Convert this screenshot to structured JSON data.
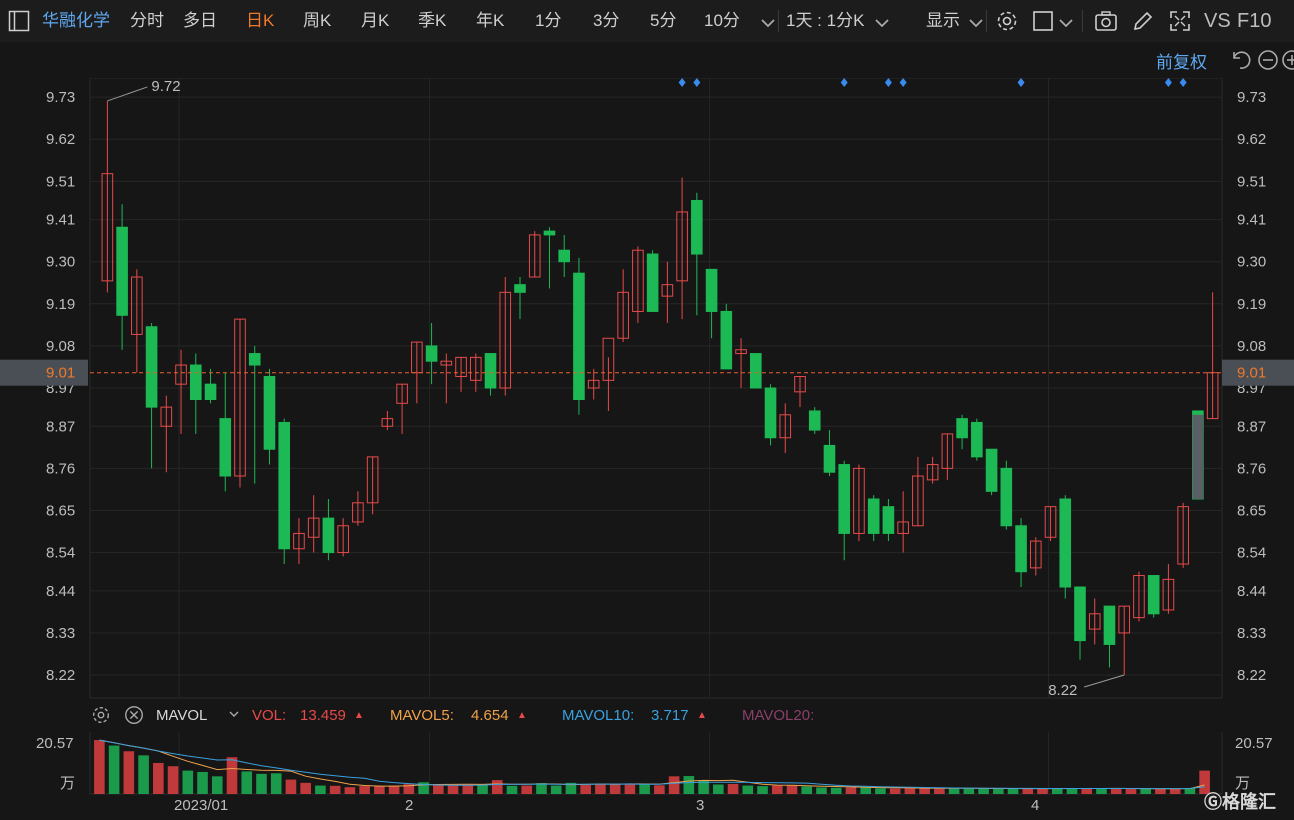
{
  "toolbar": {
    "stock_name": "华融化学",
    "periods": [
      "分时",
      "多日",
      "日K",
      "周K",
      "月K",
      "季K",
      "年K",
      "1分",
      "3分",
      "5分",
      "10分"
    ],
    "active_period": "日K",
    "combo": "1天 : 1分K",
    "display": "显示",
    "vs": "VS",
    "f10": "F10"
  },
  "fuquan": "前复权",
  "colors": {
    "up": "#e84a4a",
    "down": "#1db954",
    "ma5": "#f0a24a",
    "ma10": "#3aa0e0",
    "ma20": "#8a3f6a",
    "price_line": "#e8622a",
    "bg": "#161616",
    "grid": "#262626",
    "markers": "#3a8af0"
  },
  "price_axis": {
    "ticks": [
      "9.73",
      "9.62",
      "9.51",
      "9.41",
      "9.30",
      "9.19",
      "9.08",
      "8.97",
      "8.87",
      "8.76",
      "8.65",
      "8.54",
      "8.44",
      "8.33",
      "8.22"
    ],
    "current": "9.01",
    "high_label": "9.72",
    "low_label": "8.22"
  },
  "chart_data": {
    "type": "candlestick",
    "ylim": [
      8.16,
      9.78
    ],
    "candles": [
      {
        "o": 9.25,
        "h": 9.72,
        "l": 9.22,
        "c": 9.53
      },
      {
        "o": 9.39,
        "h": 9.45,
        "l": 9.07,
        "c": 9.16
      },
      {
        "o": 9.11,
        "h": 9.28,
        "l": 9.01,
        "c": 9.26
      },
      {
        "o": 9.13,
        "h": 9.14,
        "l": 8.76,
        "c": 8.92
      },
      {
        "o": 8.87,
        "h": 8.95,
        "l": 8.75,
        "c": 8.92
      },
      {
        "o": 8.98,
        "h": 9.07,
        "l": 8.85,
        "c": 9.03
      },
      {
        "o": 9.03,
        "h": 9.06,
        "l": 8.85,
        "c": 8.94
      },
      {
        "o": 8.98,
        "h": 9.02,
        "l": 8.93,
        "c": 8.94
      },
      {
        "o": 8.89,
        "h": 9.01,
        "l": 8.7,
        "c": 8.74
      },
      {
        "o": 8.74,
        "h": 9.15,
        "l": 8.71,
        "c": 9.15
      },
      {
        "o": 9.06,
        "h": 9.08,
        "l": 8.72,
        "c": 9.03
      },
      {
        "o": 9.0,
        "h": 9.02,
        "l": 8.77,
        "c": 8.81
      },
      {
        "o": 8.88,
        "h": 8.89,
        "l": 8.51,
        "c": 8.55
      },
      {
        "o": 8.55,
        "h": 8.63,
        "l": 8.51,
        "c": 8.59
      },
      {
        "o": 8.58,
        "h": 8.69,
        "l": 8.54,
        "c": 8.63
      },
      {
        "o": 8.63,
        "h": 8.68,
        "l": 8.52,
        "c": 8.54
      },
      {
        "o": 8.54,
        "h": 8.63,
        "l": 8.53,
        "c": 8.61
      },
      {
        "o": 8.62,
        "h": 8.7,
        "l": 8.61,
        "c": 8.67
      },
      {
        "o": 8.67,
        "h": 8.79,
        "l": 8.64,
        "c": 8.79
      },
      {
        "o": 8.87,
        "h": 8.91,
        "l": 8.86,
        "c": 8.89
      },
      {
        "o": 8.93,
        "h": 8.98,
        "l": 8.85,
        "c": 8.98
      },
      {
        "o": 9.01,
        "h": 9.09,
        "l": 8.93,
        "c": 9.09
      },
      {
        "o": 9.08,
        "h": 9.14,
        "l": 8.98,
        "c": 9.04
      },
      {
        "o": 9.03,
        "h": 9.06,
        "l": 8.93,
        "c": 9.04
      },
      {
        "o": 9.0,
        "h": 9.05,
        "l": 8.96,
        "c": 9.05
      },
      {
        "o": 8.99,
        "h": 9.06,
        "l": 8.96,
        "c": 9.05
      },
      {
        "o": 9.06,
        "h": 9.06,
        "l": 8.95,
        "c": 8.97
      },
      {
        "o": 8.97,
        "h": 9.26,
        "l": 8.95,
        "c": 9.22
      },
      {
        "o": 9.24,
        "h": 9.26,
        "l": 9.15,
        "c": 9.22
      },
      {
        "o": 9.26,
        "h": 9.38,
        "l": 9.26,
        "c": 9.37
      },
      {
        "o": 9.38,
        "h": 9.39,
        "l": 9.23,
        "c": 9.37
      },
      {
        "o": 9.33,
        "h": 9.37,
        "l": 9.26,
        "c": 9.3
      },
      {
        "o": 9.27,
        "h": 9.31,
        "l": 8.9,
        "c": 8.94
      },
      {
        "o": 8.97,
        "h": 9.02,
        "l": 8.94,
        "c": 8.99
      },
      {
        "o": 8.99,
        "h": 9.05,
        "l": 8.91,
        "c": 9.1
      },
      {
        "o": 9.1,
        "h": 9.28,
        "l": 9.09,
        "c": 9.22
      },
      {
        "o": 9.17,
        "h": 9.34,
        "l": 9.14,
        "c": 9.33
      },
      {
        "o": 9.32,
        "h": 9.33,
        "l": 9.18,
        "c": 9.17
      },
      {
        "o": 9.21,
        "h": 9.3,
        "l": 9.14,
        "c": 9.24
      },
      {
        "o": 9.25,
        "h": 9.52,
        "l": 9.15,
        "c": 9.43
      },
      {
        "o": 9.46,
        "h": 9.48,
        "l": 9.16,
        "c": 9.32
      },
      {
        "o": 9.28,
        "h": 9.28,
        "l": 9.1,
        "c": 9.17
      },
      {
        "o": 9.17,
        "h": 9.19,
        "l": 9.02,
        "c": 9.02
      },
      {
        "o": 9.06,
        "h": 9.1,
        "l": 8.97,
        "c": 9.07
      },
      {
        "o": 9.06,
        "h": 9.06,
        "l": 8.97,
        "c": 8.97
      },
      {
        "o": 8.97,
        "h": 8.98,
        "l": 8.82,
        "c": 8.84
      },
      {
        "o": 8.84,
        "h": 8.93,
        "l": 8.8,
        "c": 8.9
      },
      {
        "o": 8.96,
        "h": 9.0,
        "l": 8.92,
        "c": 9.0
      },
      {
        "o": 8.91,
        "h": 8.92,
        "l": 8.85,
        "c": 8.86
      },
      {
        "o": 8.82,
        "h": 8.86,
        "l": 8.74,
        "c": 8.75
      },
      {
        "o": 8.77,
        "h": 8.78,
        "l": 8.52,
        "c": 8.59
      },
      {
        "o": 8.59,
        "h": 8.77,
        "l": 8.57,
        "c": 8.76
      },
      {
        "o": 8.68,
        "h": 8.69,
        "l": 8.57,
        "c": 8.59
      },
      {
        "o": 8.66,
        "h": 8.68,
        "l": 8.57,
        "c": 8.59
      },
      {
        "o": 8.59,
        "h": 8.7,
        "l": 8.54,
        "c": 8.62
      },
      {
        "o": 8.61,
        "h": 8.79,
        "l": 8.61,
        "c": 8.74
      },
      {
        "o": 8.73,
        "h": 8.79,
        "l": 8.72,
        "c": 8.77
      },
      {
        "o": 8.76,
        "h": 8.85,
        "l": 8.73,
        "c": 8.85
      },
      {
        "o": 8.89,
        "h": 8.9,
        "l": 8.81,
        "c": 8.84
      },
      {
        "o": 8.88,
        "h": 8.89,
        "l": 8.78,
        "c": 8.79
      },
      {
        "o": 8.81,
        "h": 8.81,
        "l": 8.69,
        "c": 8.7
      },
      {
        "o": 8.76,
        "h": 8.78,
        "l": 8.6,
        "c": 8.61
      },
      {
        "o": 8.61,
        "h": 8.63,
        "l": 8.45,
        "c": 8.49
      },
      {
        "o": 8.5,
        "h": 8.58,
        "l": 8.48,
        "c": 8.57
      },
      {
        "o": 8.58,
        "h": 8.66,
        "l": 8.57,
        "c": 8.66
      },
      {
        "o": 8.68,
        "h": 8.69,
        "l": 8.42,
        "c": 8.45
      },
      {
        "o": 8.45,
        "h": 8.45,
        "l": 8.26,
        "c": 8.31
      },
      {
        "o": 8.34,
        "h": 8.42,
        "l": 8.3,
        "c": 8.38
      },
      {
        "o": 8.4,
        "h": 8.4,
        "l": 8.24,
        "c": 8.3
      },
      {
        "o": 8.33,
        "h": 8.4,
        "l": 8.22,
        "c": 8.4
      },
      {
        "o": 8.37,
        "h": 8.49,
        "l": 8.36,
        "c": 8.48
      },
      {
        "o": 8.48,
        "h": 8.48,
        "l": 8.37,
        "c": 8.38
      },
      {
        "o": 8.39,
        "h": 8.51,
        "l": 8.38,
        "c": 8.47
      },
      {
        "o": 8.51,
        "h": 8.67,
        "l": 8.5,
        "c": 8.66
      },
      {
        "o": 8.91,
        "h": 8.91,
        "l": 8.68,
        "c": 8.68
      },
      {
        "o": 8.89,
        "h": 9.22,
        "l": 8.89,
        "c": 9.01
      }
    ],
    "current_price": 9.01,
    "x_labels": [
      "2023/01",
      "2",
      "3",
      "4"
    ],
    "volume": [
      19.8,
      17.8,
      15.7,
      14.2,
      11.4,
      10.2,
      8.6,
      8.1,
      6.5,
      13.5,
      8.3,
      7.4,
      7.6,
      5.3,
      4.1,
      3.1,
      3.0,
      2.5,
      2.9,
      3.0,
      3.1,
      3.6,
      4.3,
      3.5,
      3.1,
      3.4,
      3.4,
      5.1,
      3.0,
      3.1,
      4.0,
      3.1,
      4.1,
      3.3,
      3.8,
      3.6,
      3.8,
      3.8,
      3.2,
      6.5,
      6.6,
      4.8,
      3.5,
      3.7,
      3.1,
      2.9,
      3.1,
      3.2,
      2.8,
      2.4,
      2.3,
      2.4,
      2.5,
      2.1,
      2.0,
      2.2,
      2.1,
      2.0,
      2.1,
      2.0,
      2.0,
      2.0,
      2.0,
      2.0,
      1.9,
      2.1,
      2.1,
      2.0,
      2.0,
      2.0,
      2.0,
      1.9,
      1.9,
      1.9,
      2.2,
      8.6
    ],
    "volume_ylim": [
      0,
      20.57
    ],
    "volume_top_label": "20.57",
    "volume_unit": "万"
  },
  "markers_count": 8,
  "mavol": {
    "name": "MAVOL",
    "vol_label": "VOL:",
    "vol_value": "13.459",
    "ma5_label": "MAVOL5:",
    "ma5_value": "4.654",
    "ma10_label": "MAVOL10:",
    "ma10_value": "3.717",
    "ma20_label": "MAVOL20:"
  }
}
